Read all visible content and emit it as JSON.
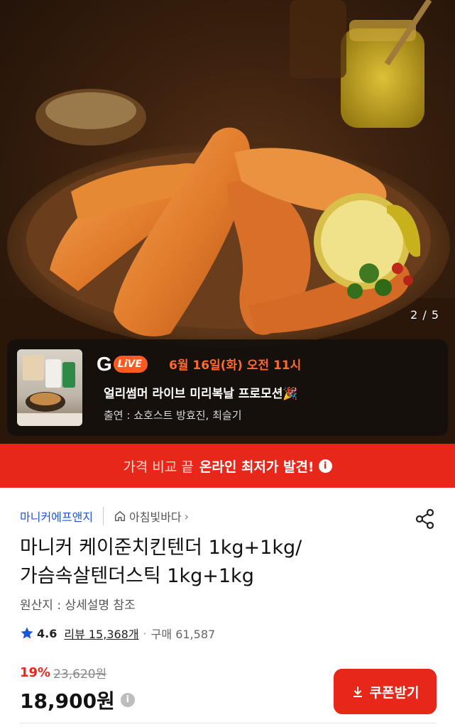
{
  "hero": {
    "page_counter": "2 / 5"
  },
  "live_banner": {
    "logo_g": "G",
    "logo_live": "LiVE",
    "date_time": "6월 16일(화) 오전 11시",
    "title": "얼리썸머 라이브 미리복날 프로모션🎉",
    "cast": "출연 : 쇼호스트 방효진, 최슬기"
  },
  "promo_strip": {
    "text_normal": "가격 비교 끝",
    "text_bold": "온라인 최저가 발견!",
    "info_glyph": "i",
    "color": "#e8271b"
  },
  "product": {
    "seller": "마니커에프앤지",
    "store": "아침빛바다",
    "store_chevron": "›",
    "title_line1": "마니커 케이준치킨텐더 1kg+1kg/",
    "title_line2": "가슴속살텐더스틱 1kg+1kg",
    "origin": "원산지 : 상세설명 참조",
    "rating": "4.6",
    "reviews": "리뷰 15,368개",
    "dot": "·",
    "purchases": "구매 61,587",
    "discount": "19%",
    "original_price": "23,620원",
    "price": "18,900원",
    "price_info_glyph": "i",
    "coupon_button": "쿠폰받기"
  },
  "icons": {
    "share": "share-icon",
    "home": "home-icon",
    "star": "star-icon",
    "download": "download-icon"
  },
  "colors": {
    "accent_red": "#e8271b",
    "seller_blue": "#1a57d6",
    "live_orange": "#ff5a1f",
    "star_blue": "#1a57d6"
  }
}
